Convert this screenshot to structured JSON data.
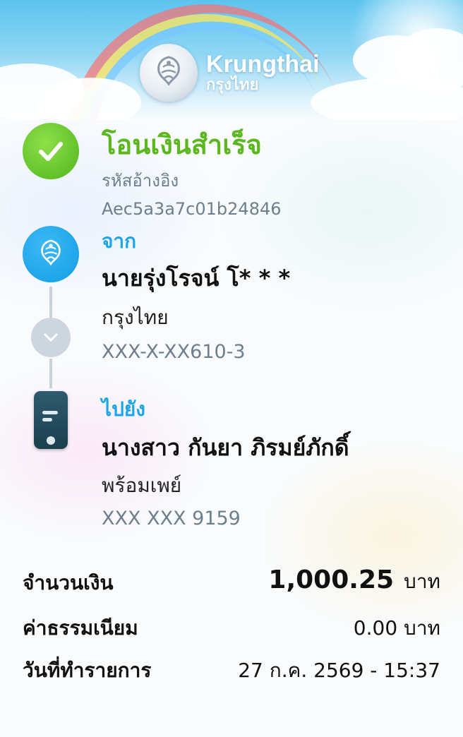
{
  "header": {
    "brand_en": "Krungthai",
    "brand_th": "กรุงไทย"
  },
  "status": {
    "title": "โอนเงินสำเร็จ",
    "reference_label": "รหัสอ้างอิง",
    "reference_value": "Aec5a3a7c01b24846"
  },
  "from": {
    "label": "จาก",
    "name": "นายรุ่งโรจน์ โ* * *",
    "bank": "กรุงไทย",
    "account": "XXX-X-XX610-3"
  },
  "to": {
    "label": "ไปยัง",
    "name": "นางสาว กันยา ภิรมย์ภักดิ์",
    "service": "พร้อมเพย์",
    "account": "XXX XXX 9159"
  },
  "summary": {
    "amount_label": "จำนวนเงิน",
    "amount_value": "1,000.25",
    "amount_unit": "บาท",
    "fee_label": "ค่าธรรมเนียม",
    "fee_value": "0.00",
    "fee_unit": "บาท",
    "date_label": "วันที่ทำรายการ",
    "date_value": "27 ก.ค. 2569 - 15:37"
  },
  "colors": {
    "success_green": "#5ab71e",
    "brand_blue": "#1aa6e8",
    "muted_gray": "#6d7f8e"
  },
  "icons": {
    "status": "check-icon",
    "from": "krungthai-bird-icon",
    "connector": "chevron-down-icon",
    "to": "mobile-phone-icon"
  }
}
